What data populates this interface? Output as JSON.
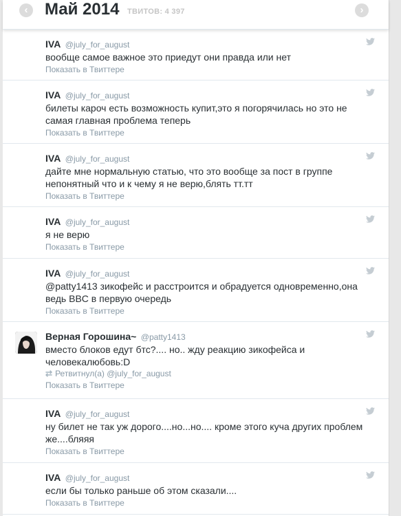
{
  "header": {
    "prev_icon": "chevron-left-icon",
    "next_icon": "chevron-right-icon",
    "prev_glyph": "‹",
    "next_glyph": "›",
    "month": "Май 2014",
    "count_label": "ТВИТОВ: 4 397"
  },
  "action_label": "Показать в Твиттере",
  "tweets": [
    {
      "name": "IVA",
      "handle": "@july_for_august",
      "text": "вообще самое важное это приедут они правда или нет"
    },
    {
      "name": "IVA",
      "handle": "@july_for_august",
      "text": "билеты кароч есть возможность купит,это я погорячилась но это не самая главная проблема теперь"
    },
    {
      "name": "IVA",
      "handle": "@july_for_august",
      "text": "дайте мне нормальную статью, что это вообще за пост в группе непонятный что и к чему я не верю,блять тт.тт"
    },
    {
      "name": "IVA",
      "handle": "@july_for_august",
      "text": "я не верю"
    },
    {
      "name": "IVA",
      "handle": "@july_for_august",
      "text": "@patty1413 зикофейс и расстроится и обрадуется одновременно,она ведь BBC в первую очередь"
    },
    {
      "name": "Верная Горошина~",
      "handle": "@patty1413",
      "text": "вместо блоков едут бтс?.... но.. жду реакцию зикофейса и человекалюбовь:D",
      "retweet": "Ретвитнул(а) @july_for_august",
      "has_avatar": true
    },
    {
      "name": "IVA",
      "handle": "@july_for_august",
      "text": "ну билет не так уж дорого....но...но.... кроме этого куча других проблем же....бляяя"
    },
    {
      "name": "IVA",
      "handle": "@july_for_august",
      "text": "если бы только раньше об этом сказали...."
    }
  ],
  "colors": {
    "name": "#292f33",
    "secondary": "#8899a6",
    "divider": "#e1e8ed",
    "bird": "#c5cdd3"
  }
}
